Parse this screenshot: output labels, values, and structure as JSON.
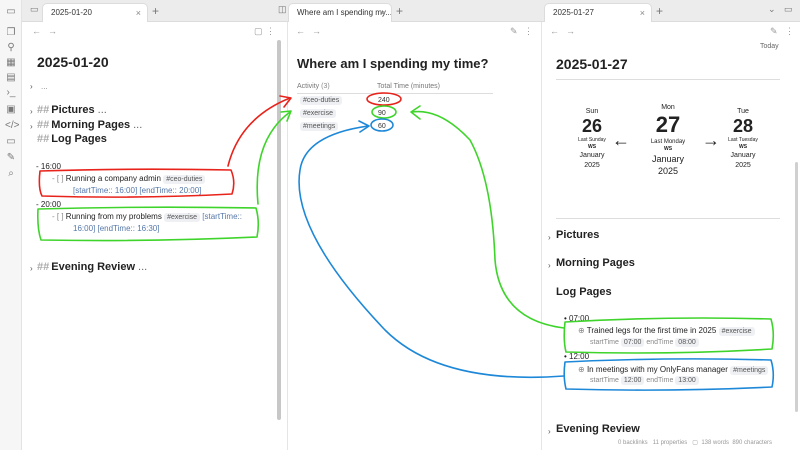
{
  "tabs": {
    "left": "2025-01-20",
    "middle": "Where am I spending my...",
    "right": "2025-01-27"
  },
  "left": {
    "title": "2025-01-20",
    "collapsed": "...",
    "headings": [
      {
        "label": "Pictures",
        "dots": "..."
      },
      {
        "label": "Morning Pages",
        "dots": "..."
      },
      {
        "label": "Log Pages",
        "dots": ""
      }
    ],
    "log": [
      {
        "time": "16:00",
        "text": "Running a company admin",
        "tag": "#ceo-duties",
        "start": "[startTime:: 16:00]",
        "end": "[endTime:: 20:00]"
      },
      {
        "time": "20:00",
        "text": "Running from my problems",
        "tag": "#exercise",
        "start": "[startTime::",
        "start2": "16:00]",
        "end": "[endTime:: 16:30]"
      }
    ],
    "evening": "Evening Review",
    "evening_dots": "..."
  },
  "middle": {
    "title": "Where am I spending my time?",
    "col_activity": "Activity",
    "col_count": "(3)",
    "col_total": "Total Time (minutes)",
    "rows": [
      {
        "activity": "#ceo-duties",
        "total": "240"
      },
      {
        "activity": "#exercise",
        "total": "90"
      },
      {
        "activity": "#meetings",
        "total": "60"
      }
    ]
  },
  "right": {
    "today": "Today",
    "title": "2025-01-27",
    "cal": {
      "prev": {
        "dn": "Sun",
        "num": "26",
        "meta": "Last Sunday",
        "ws": "WS",
        "mo": "January",
        "yr": "2025"
      },
      "cur": {
        "dn": "Mon",
        "num": "27",
        "meta": "Last Monday",
        "ws": "WS",
        "mo": "January",
        "yr": "2025"
      },
      "next": {
        "dn": "Tue",
        "num": "28",
        "meta": "Last Tuesday",
        "ws": "WS",
        "mo": "January",
        "yr": "2025"
      },
      "left_arrow": "←",
      "right_arrow": "→"
    },
    "headings": {
      "pictures": "Pictures",
      "morning": "Morning Pages",
      "log": "Log Pages",
      "evening": "Evening Review"
    },
    "log": [
      {
        "time": "07:00",
        "text": "Trained legs for the first time in 2025",
        "tag": "#exercise",
        "start_label": "startTime",
        "start": "07:00",
        "end_label": "endTime",
        "end": "08:00"
      },
      {
        "time": "12:00",
        "text": "In meetings with my OnlyFans manager",
        "tag": "#meetings",
        "start_label": "startTime",
        "start": "12:00",
        "end_label": "endTime",
        "end": "13:00"
      }
    ],
    "footer": {
      "backlinks": "0 backlinks",
      "props": "11 properties",
      "words": "138 words",
      "chars": "890 characters"
    }
  },
  "colors": {
    "red": "#e8231b",
    "green": "#3fd42b",
    "blue": "#1e88d8"
  }
}
